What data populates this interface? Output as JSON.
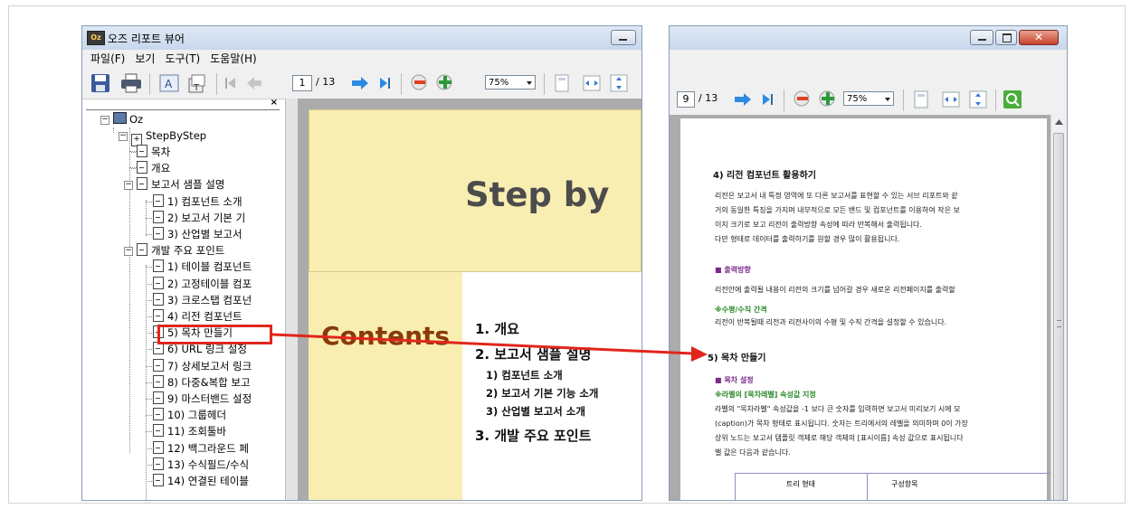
{
  "left_window": {
    "title": "오즈 리포트 뷰어",
    "app_icon_text": "Oz",
    "menu": [
      "파일(F)",
      "보기",
      "도구(T)",
      "도움말(H)"
    ],
    "page_current": "1",
    "page_total": "/ 13",
    "zoom": "75%",
    "tree": {
      "root": "Oz",
      "report": "StepByStep",
      "items": [
        {
          "label": "목차",
          "level": 2
        },
        {
          "label": "개요",
          "level": 2
        },
        {
          "label": "보고서 샘플 설명",
          "level": 2,
          "expanded": true
        },
        {
          "label": "1) 컴포넌트 소개",
          "level": 3
        },
        {
          "label": "2) 보고서 기본 기",
          "level": 3
        },
        {
          "label": "3) 산업별 보고서 ",
          "level": 3
        },
        {
          "label": "개발 주요 포인트",
          "level": 2,
          "expanded": true
        },
        {
          "label": "1) 테이블 컴포넌트",
          "level": 3
        },
        {
          "label": "2) 고정테이블 컴포",
          "level": 3
        },
        {
          "label": "3) 크로스탭 컴포넌",
          "level": 3
        },
        {
          "label": "4) 리전 컴포넌트",
          "level": 3
        },
        {
          "label": "5) 목차 만들기",
          "level": 3,
          "highlighted": true
        },
        {
          "label": "6) URL 링크 설정",
          "level": 3
        },
        {
          "label": "7) 상세보고서 링크",
          "level": 3
        },
        {
          "label": "8) 다중&복합 보고",
          "level": 3
        },
        {
          "label": "9) 마스터밴드 설정",
          "level": 3
        },
        {
          "label": "10) 그룹헤더",
          "level": 3
        },
        {
          "label": "11) 조회툴바",
          "level": 3
        },
        {
          "label": "12) 백그라운드 페",
          "level": 3
        },
        {
          "label": "13) 수식필드/수식",
          "level": 3
        },
        {
          "label": "14) 연결된 테이블",
          "level": 3
        }
      ]
    },
    "document": {
      "banner_title": "Step by",
      "contents_label": "Contents",
      "toc": [
        {
          "text": "1. 개요",
          "level": 1
        },
        {
          "text": "2. 보고서 샘플 설명",
          "level": 1
        },
        {
          "text": "1) 컴포넌트 소개",
          "level": 2
        },
        {
          "text": "2) 보고서 기본 기능 소개",
          "level": 2
        },
        {
          "text": "3) 산업별 보고서 소개",
          "level": 2
        },
        {
          "text": "3. 개발 주요 포인트",
          "level": 1
        }
      ]
    }
  },
  "right_window": {
    "page_current": "9",
    "page_total": "/ 13",
    "zoom": "75%",
    "document": {
      "section4_title": "4) 리전 컴포넌트 활용하기",
      "section4_lines": [
        "리전은 보고서 내 특정 영역에 또 다른 보고서를 표현할 수 있는 서브 리포트와 같",
        "거의 동일한 특징을 가지며 내부적으로 모든 밴드 및 컴포넌트를 이용하여 작은 보",
        "이지 크기로 보고 리전이 출력방향 속성에 따라 반복해서 출력됩니다.",
        "다만 형태로 데이터를 출력하기를 원할 경우 많이 활용됩니다."
      ],
      "output_dir_title": "■ 출력방향",
      "output_dir_text": "리전안에 출력될 내용이 리전의 크기를 넘어갈 경우 새로운 리전페이지를 출력할",
      "spacing_title": "※수평/수직 간격",
      "spacing_text": "리전이 반복될때 리전과 리전사이의 수평 및 수직 간격을 설정할 수 있습니다.",
      "section5_title": "5) 목차 만들기",
      "toc_setting_title": "■ 목차 설정",
      "toc_level_title": "※라벨의 [목차레벨] 속성값 지정",
      "toc_lines": [
        "라벨의 \"목차라벨\" 속성값을 -1 보다 큰 숫자를 입력하면 보고서 미리보기 시에 ﻿모",
        "(caption)가 목차 형태로 표시됩니다. 숫자는 트리에서의 레벨을 의미하며 0이 가장",
        "상위 노드는 보고서 템플릿 객체로 해당 객체의 [표시이름] 속성 값으로 표시됩니다",
        "벨 값은 다음과 같습니다."
      ],
      "table_headers": [
        "트리 형태",
        "구성항목"
      ]
    }
  },
  "colors": {
    "banner": "#f9eeb2",
    "contents_text": "#8a3a0a",
    "annotation": "#e1261c",
    "subheading_purple": "#7a2a8a",
    "subheading_green": "#2a8a2a"
  }
}
